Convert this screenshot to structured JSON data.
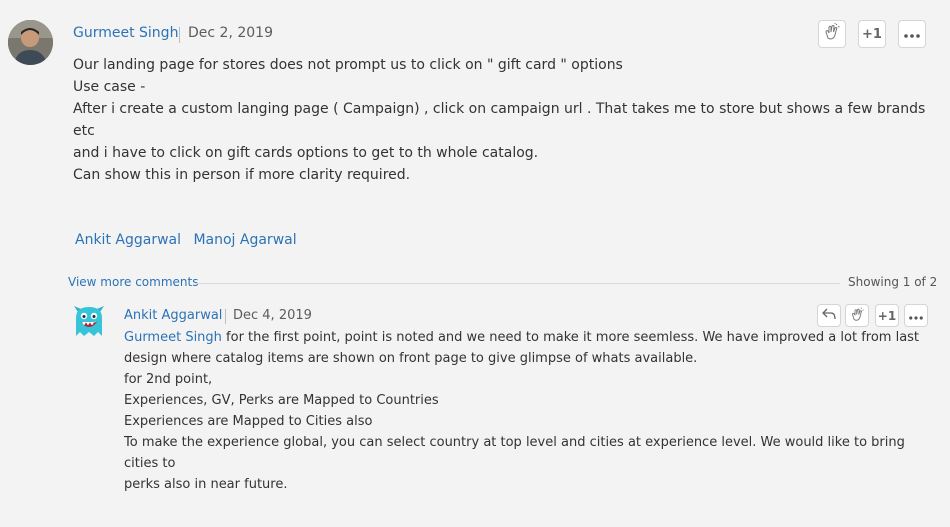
{
  "post": {
    "author": "Gurmeet Singh",
    "date": "Dec 2, 2019",
    "plus_one": "+1",
    "lines": [
      "Our landing page for stores does not prompt us to click on \" gift card \" options",
      "",
      "Use case -",
      "After i create a custom langing page ( Campaign) , click on campaign url . That takes me to store but shows a few brands etc",
      "and i have to click on gift cards options to get to th whole catalog.",
      "",
      "Can show this in person if more clarity required."
    ],
    "mentions": [
      "Ankit Aggarwal",
      "Manoj Agarwal"
    ]
  },
  "comments_bar": {
    "view_more": "View more comments",
    "showing": "Showing 1 of 2"
  },
  "reply": {
    "author": "Ankit Aggarwal",
    "date": "Dec 4, 2019",
    "plus_one": "+1",
    "mention": "Gurmeet Singh",
    "first_line_rest": " for the first point, point is noted and we need to make it more seemless. We have improved a lot from last",
    "lines": [
      "design where catalog items are shown on front page to give glimpse of whats available.",
      "",
      "for 2nd point,",
      "Experiences, GV, Perks are Mapped to Countries",
      "Experiences are Mapped to Cities also",
      "",
      "To make the experience global, you can select country at top level and cities at experience level. We would like to bring cities to",
      "perks also in near future."
    ]
  },
  "icons": {
    "clap": "clap-icon",
    "more": "more-horizontal-icon",
    "reply": "reply-icon"
  },
  "colors": {
    "link": "#2c73b6",
    "background": "#f3f3f3",
    "text": "#333333"
  }
}
